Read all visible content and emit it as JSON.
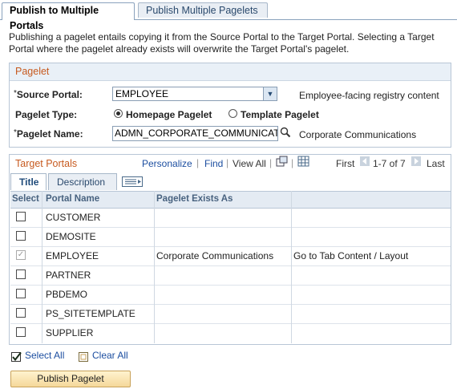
{
  "tabs": [
    {
      "label": "Publish to Multiple Portals",
      "active": true
    },
    {
      "label": "Publish Multiple Pagelets",
      "active": false
    }
  ],
  "intro": "Publishing a pagelet entails copying it from the Source Portal to the Target Portal. Selecting a Target Portal where the pagelet already exists will overwrite the Target Portal's pagelet.",
  "pagelet": {
    "title": "Pagelet",
    "source_portal_label": "Source Portal:",
    "source_portal_value": "EMPLOYEE",
    "source_portal_desc": "Employee-facing registry content",
    "pagelet_type_label": "Pagelet Type:",
    "type_options": [
      {
        "label": "Homepage Pagelet",
        "selected": true
      },
      {
        "label": "Template Pagelet",
        "selected": false
      }
    ],
    "pagelet_name_label": "Pagelet Name:",
    "pagelet_name_value": "ADMN_CORPORATE_COMMUNICATI",
    "pagelet_name_desc": "Corporate Communications",
    "required_mark": "*"
  },
  "targets": {
    "title": "Target Portals",
    "toolbar": {
      "personalize": "Personalize",
      "find": "Find",
      "view_all": "View All",
      "first": "First",
      "range": "1-7 of 7",
      "last": "Last"
    },
    "subtabs": [
      {
        "label": "Title",
        "active": true
      },
      {
        "label": "Description",
        "active": false
      }
    ],
    "columns": [
      "Select",
      "Portal Name",
      "Pagelet Exists As",
      ""
    ],
    "rows": [
      {
        "name": "CUSTOMER",
        "exists_as": "",
        "link": "",
        "checked": false,
        "disabled": false
      },
      {
        "name": "DEMOSITE",
        "exists_as": "",
        "link": "",
        "checked": false,
        "disabled": false
      },
      {
        "name": "EMPLOYEE",
        "exists_as": "Corporate Communications",
        "link": "Go to Tab Content / Layout",
        "checked": true,
        "disabled": true
      },
      {
        "name": "PARTNER",
        "exists_as": "",
        "link": "",
        "checked": false,
        "disabled": false
      },
      {
        "name": "PBDEMO",
        "exists_as": "",
        "link": "",
        "checked": false,
        "disabled": false
      },
      {
        "name": "PS_SITETEMPLATE",
        "exists_as": "",
        "link": "",
        "checked": false,
        "disabled": false
      },
      {
        "name": "SUPPLIER",
        "exists_as": "",
        "link": "",
        "checked": false,
        "disabled": false
      }
    ]
  },
  "select_all": "Select All",
  "clear_all": "Clear All",
  "publish_button": "Publish Pagelet",
  "colors": {
    "accent_orange": "#c75a1f",
    "link_blue": "#1c4ea0",
    "header_blue": "#e9f0f7"
  }
}
